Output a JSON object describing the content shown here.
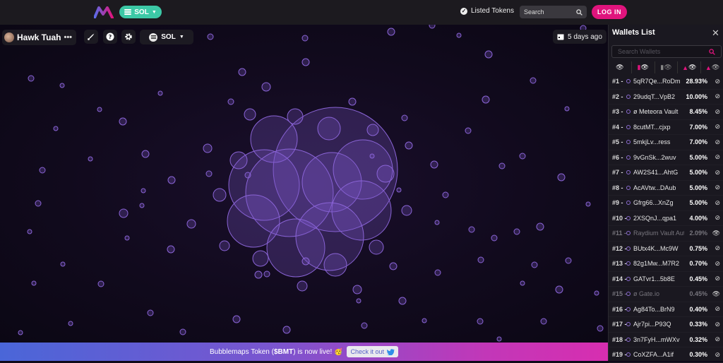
{
  "topbar": {
    "chain_label": "SOL",
    "listed_tokens_label": "Listed Tokens",
    "search_placeholder": "Search",
    "login_label": "LOG IN"
  },
  "toolbar": {
    "token_name": "Hawk Tuah",
    "more_label": "•••",
    "chain_label": "SOL",
    "date_label": "5 days ago"
  },
  "banner": {
    "text_before": "Bubblemaps Token (",
    "token_symbol": "$BMT",
    "text_after": ") is now live! 🥳",
    "cta_label": "Check it out"
  },
  "panel": {
    "title": "Wallets List",
    "search_placeholder": "Search Wallets",
    "wallets": [
      {
        "rank": "#1 -",
        "address": "5qR7Qe...RoDm",
        "percent": "28.93%",
        "dim": false
      },
      {
        "rank": "#2 -",
        "address": "29udqT...VpB2",
        "percent": "10.00%",
        "dim": false
      },
      {
        "rank": "#3 -",
        "address": "ø Meteora Vault",
        "percent": "8.45%",
        "dim": false
      },
      {
        "rank": "#4 -",
        "address": "8cutMT...cjxp",
        "percent": "7.00%",
        "dim": false
      },
      {
        "rank": "#5 -",
        "address": "5mkjLv...ress",
        "percent": "7.00%",
        "dim": false
      },
      {
        "rank": "#6 -",
        "address": "9vGnSk...2wuv",
        "percent": "5.00%",
        "dim": false
      },
      {
        "rank": "#7 -",
        "address": "AW2S41...AhtG",
        "percent": "5.00%",
        "dim": false
      },
      {
        "rank": "#8 -",
        "address": "AcAVtw...DAub",
        "percent": "5.00%",
        "dim": false
      },
      {
        "rank": "#9 -",
        "address": "Gfrg66...XnZg",
        "percent": "5.00%",
        "dim": false
      },
      {
        "rank": "#10 -",
        "address": "2XSQnJ...qpa1",
        "percent": "4.00%",
        "dim": false
      },
      {
        "rank": "#11 -",
        "address": "Raydium Vault Aut...",
        "percent": "2.09%",
        "dim": true
      },
      {
        "rank": "#12 -",
        "address": "BUtx4K...Mc9W",
        "percent": "0.75%",
        "dim": false
      },
      {
        "rank": "#13 -",
        "address": "82g1Mw...M7R2",
        "percent": "0.70%",
        "dim": false
      },
      {
        "rank": "#14 -",
        "address": "GATvr1...5b8E",
        "percent": "0.45%",
        "dim": false
      },
      {
        "rank": "#15 -",
        "address": "ø Gate.io",
        "percent": "0.45%",
        "dim": true
      },
      {
        "rank": "#16 -",
        "address": "Ag84To...BrN9",
        "percent": "0.40%",
        "dim": false
      },
      {
        "rank": "#17 -",
        "address": "Ajr7pi...P93Q",
        "percent": "0.33%",
        "dim": false
      },
      {
        "rank": "#18 -",
        "address": "3n7FyH...mWXv",
        "percent": "0.32%",
        "dim": false
      },
      {
        "rank": "#19 -",
        "address": "CoXZFA...A1if",
        "percent": "0.30%",
        "dim": false
      }
    ]
  },
  "colors": {
    "accent": "#e0147d",
    "chain": "#3cc8a6",
    "bubble": "#7b55c7"
  }
}
